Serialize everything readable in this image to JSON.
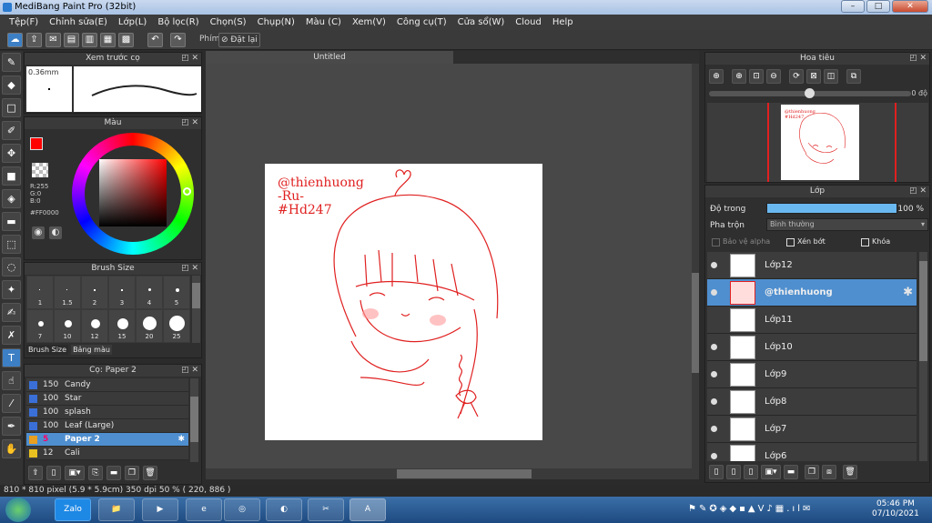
{
  "window": {
    "title": "MediBang Paint Pro (32bit)",
    "minimize": "–",
    "maximize": "□",
    "close": "✕"
  },
  "menu": [
    "Tệp(F)",
    "Chỉnh sửa(E)",
    "Lớp(L)",
    "Bộ lọc(R)",
    "Chọn(S)",
    "Chụp(N)",
    "Màu (C)",
    "Xem(V)",
    "Công cụ(T)",
    "Cửa sổ(W)",
    "Cloud",
    "Help"
  ],
  "toolbar": {
    "shortcut_label": "Phím",
    "reset_label": "Đặt lại"
  },
  "preview_panel": {
    "title": "Xem trước cọ",
    "size": "0.36mm"
  },
  "color_panel": {
    "title": "Màu",
    "r": "R:255",
    "g": "G:0",
    "b": "B:0",
    "hex": "#FF0000",
    "accent": "#ff0000"
  },
  "brush_size_panel": {
    "title": "Brush Size",
    "sizes": [
      "1",
      "1.5",
      "2",
      "3",
      "4",
      "5",
      "7",
      "10",
      "12",
      "15",
      "20",
      "25"
    ],
    "tabs": [
      "Brush Size",
      "Bảng màu"
    ]
  },
  "brush_panel": {
    "title": "Cọ: Paper 2",
    "items": [
      {
        "size": "150",
        "name": "Candy"
      },
      {
        "size": "100",
        "name": "Star"
      },
      {
        "size": "100",
        "name": "splash"
      },
      {
        "size": "100",
        "name": "Leaf (Large)"
      },
      {
        "size": "5",
        "name": "Paper 2"
      },
      {
        "size": "12",
        "name": "Cali"
      }
    ]
  },
  "document": {
    "tab": "Untitled",
    "text_line1": "@thienhuong",
    "text_line2": "-Ru-",
    "text_line3": "#Hd247"
  },
  "navigator": {
    "title": "Hoa tiêu",
    "zoom_value": "0 độ"
  },
  "layers_panel": {
    "title": "Lớp",
    "opacity_label": "Độ trong",
    "opacity_value": "100 %",
    "opacity_fraction": 1.0,
    "blend_label": "Pha trộn",
    "blend_value": "Bình thường",
    "protect_alpha": "Bảo vệ alpha",
    "clip": "Xén bớt",
    "lock": "Khóa",
    "layers": [
      "Lớp12",
      "@thienhuong",
      "Lớp11",
      "Lớp10",
      "Lớp9",
      "Lớp8",
      "Lớp7",
      "Lớp6"
    ]
  },
  "status": "810 * 810 pixel  (5.9 * 5.9cm)  350 dpi  50 %  ( 220, 886 )",
  "taskbar": {
    "zalo": "Zalo",
    "time": "05:46 PM",
    "date": "07/10/2021"
  }
}
